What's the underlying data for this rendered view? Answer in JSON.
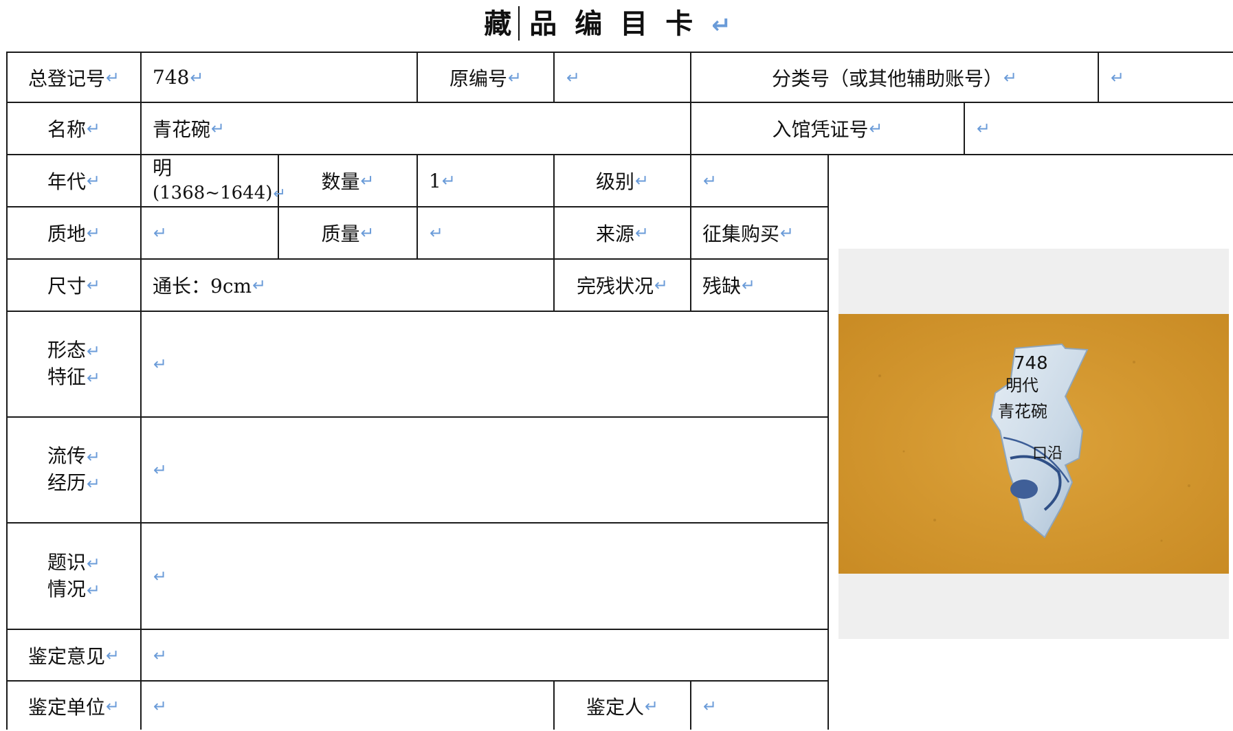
{
  "title": "藏品编目卡",
  "return_mark": "↵",
  "colors": {
    "border": "#1a1a1a",
    "return_mark": "#6a9bd8",
    "photo_bg": "#efefef",
    "cloth": "#d4982d"
  },
  "rows": {
    "r1": {
      "reg_no_label": "总登记号",
      "reg_no_value": "748",
      "orig_no_label": "原编号",
      "orig_no_value": "",
      "class_no_label": "分类号（或其他辅助账号）",
      "class_no_value": ""
    },
    "r2": {
      "name_label": "名称",
      "name_value": "青花碗",
      "voucher_label": "入馆凭证号",
      "voucher_value": ""
    },
    "r3": {
      "era_label": "年代",
      "era_line1": "明",
      "era_line2": "(1368~1644)",
      "qty_label": "数量",
      "qty_value": "1",
      "grade_label": "级别",
      "grade_value": ""
    },
    "r4": {
      "material_label": "质地",
      "material_value": "",
      "weight_label": "质量",
      "weight_value": "",
      "source_label": "来源",
      "source_value": "征集购买"
    },
    "r5": {
      "size_label": "尺寸",
      "size_value": "通长：9cm",
      "condition_label": "完残状况",
      "condition_value": "残缺"
    },
    "r6": {
      "label_line1": "形态",
      "label_line2": "特征",
      "value": ""
    },
    "r7": {
      "label_line1": "流传",
      "label_line2": "经历",
      "value": ""
    },
    "r8": {
      "label_line1": "题识",
      "label_line2": "情况",
      "value": ""
    },
    "r9": {
      "opinion_label": "鉴定意见",
      "opinion_value": ""
    },
    "r10": {
      "unit_label": "鉴定单位",
      "unit_value": "",
      "appraiser_label": "鉴定人",
      "appraiser_value": ""
    }
  },
  "photo": {
    "description": "青花碗残片照片",
    "inscription": [
      "748",
      "明代",
      "青花碗",
      "口沿"
    ]
  }
}
